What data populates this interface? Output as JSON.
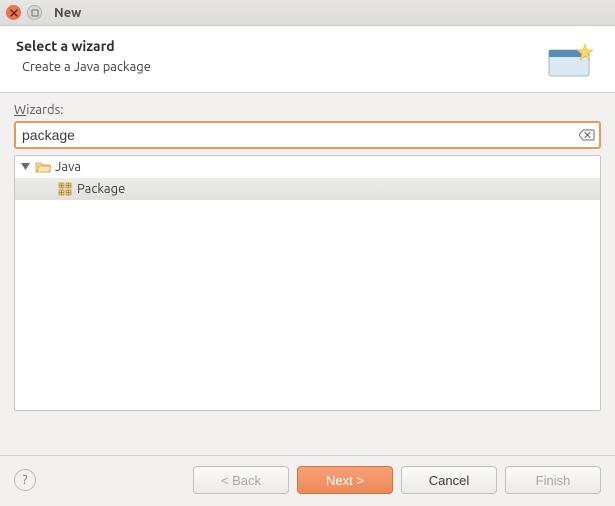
{
  "window": {
    "title": "New"
  },
  "header": {
    "title": "Select a wizard",
    "subtitle": "Create a Java package"
  },
  "body": {
    "wizards_label_pre": "",
    "wizards_label_accel": "W",
    "wizards_label_post": "izards:",
    "filter_value": "package"
  },
  "tree": {
    "items": [
      {
        "label": "Java"
      },
      {
        "label": "Package"
      }
    ]
  },
  "buttons": {
    "back": "< Back",
    "next": "Next >",
    "cancel": "Cancel",
    "finish": "Finish"
  }
}
